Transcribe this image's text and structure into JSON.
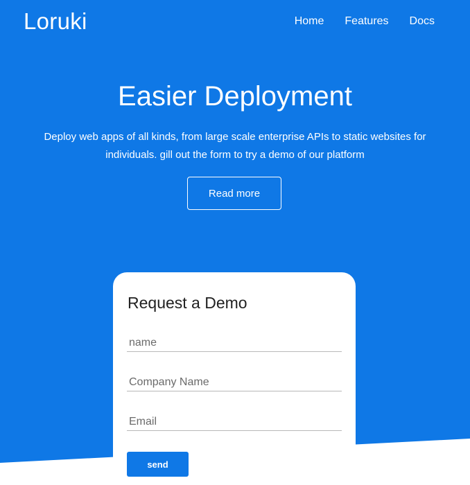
{
  "brand": {
    "name": "Loruki",
    "accent_color": "#0f78e6"
  },
  "nav": {
    "items": [
      {
        "label": "Home"
      },
      {
        "label": "Features"
      },
      {
        "label": "Docs"
      }
    ]
  },
  "hero": {
    "title": "Easier Deployment",
    "description": "Deploy web apps of all kinds, from large scale enterprise APIs to static websites for individuals. gill out the form to try a demo of our platform",
    "cta_label": "Read more"
  },
  "demo_form": {
    "title": "Request a Demo",
    "name_placeholder": "name",
    "company_placeholder": "Company Name",
    "email_placeholder": "Email",
    "submit_label": "send"
  }
}
